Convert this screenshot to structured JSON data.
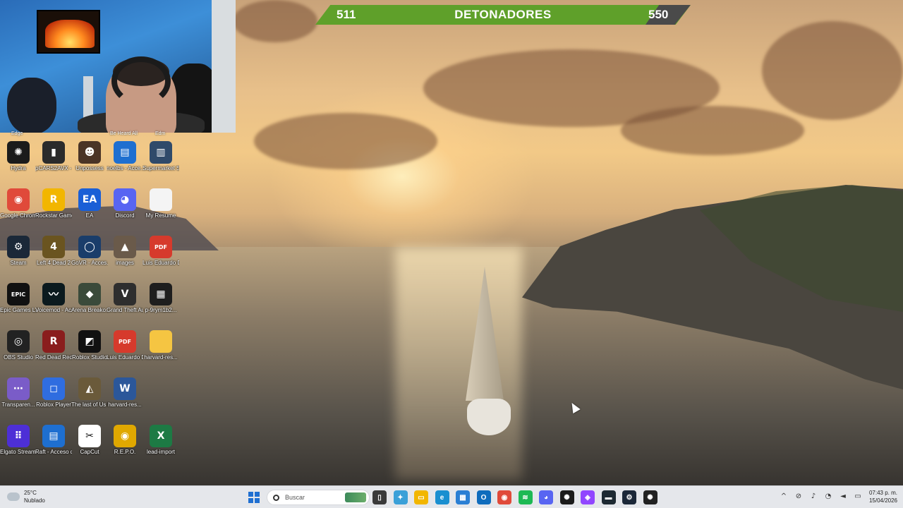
{
  "score_bar": {
    "left_value": "511",
    "title": "DETONADORES",
    "right_value": "550"
  },
  "desktop_icons": [
    {
      "label": "Hydra",
      "icon": "hydra-icon",
      "color": "#1b1b1b",
      "glyph": "✺",
      "col": 0,
      "row": 0
    },
    {
      "label": "pCARS2AVX - Acceso dire...",
      "icon": "pcars-icon",
      "color": "#2b2b2b",
      "glyph": "▮",
      "col": 1,
      "row": 0
    },
    {
      "label": "Unpossess",
      "icon": "unpossess-icon",
      "color": "#4a3426",
      "glyph": "☻",
      "col": 2,
      "row": 0
    },
    {
      "label": "noelbs - Acce...",
      "icon": "shortcut-icon",
      "color": "#1e6fd0",
      "glyph": "▤",
      "col": 3,
      "row": 0
    },
    {
      "label": "Supermarket Simulator",
      "icon": "supermarket-icon",
      "color": "#2f4a6a",
      "glyph": "▥",
      "col": 4,
      "row": 0
    },
    {
      "label": "Google Chrome",
      "icon": "chrome-icon",
      "color": "#e04a3a",
      "glyph": "◉",
      "col": 0,
      "row": 1
    },
    {
      "label": "Rockstar Games ...",
      "icon": "rockstar-icon",
      "color": "#f2b600",
      "glyph": "R",
      "col": 1,
      "row": 1
    },
    {
      "label": "EA",
      "icon": "ea-icon",
      "color": "#1a5fd6",
      "glyph": "EA",
      "col": 2,
      "row": 1
    },
    {
      "label": "Discord",
      "icon": "discord-icon",
      "color": "#5865f2",
      "glyph": "◕",
      "col": 3,
      "row": 1
    },
    {
      "label": "My Resume",
      "icon": "document-icon",
      "color": "#f4f4f4",
      "glyph": "",
      "col": 4,
      "row": 1
    },
    {
      "label": "Steam",
      "icon": "steam-icon",
      "color": "#1b2838",
      "glyph": "⚙",
      "col": 0,
      "row": 2
    },
    {
      "label": "Left 4 Dead 2",
      "icon": "l4d2-icon",
      "color": "#6a5420",
      "glyph": "4",
      "col": 1,
      "row": 2
    },
    {
      "label": "GoVR - Acces...",
      "icon": "govr-icon",
      "color": "#1a3d6a",
      "glyph": "◯",
      "col": 2,
      "row": 2
    },
    {
      "label": "images",
      "icon": "images-icon",
      "color": "#6a5a4a",
      "glyph": "▲",
      "col": 3,
      "row": 2
    },
    {
      "label": "Luis Eduardo Diaz Bernal...",
      "icon": "pdf-icon",
      "color": "#d63a2c",
      "glyph": "PDF",
      "col": 4,
      "row": 2
    },
    {
      "label": "Epic Games Launcher",
      "icon": "epic-icon",
      "color": "#111111",
      "glyph": "EPIC",
      "col": 0,
      "row": 3
    },
    {
      "label": "Voicemod - Acceso di...",
      "icon": "voicemod-icon",
      "color": "#0b1a1e",
      "glyph": "〰",
      "col": 1,
      "row": 3
    },
    {
      "label": "Arena Breako...",
      "icon": "arena-icon",
      "color": "#3a4a3a",
      "glyph": "◆",
      "col": 2,
      "row": 3
    },
    {
      "label": "Grand Theft Auto V",
      "icon": "gta-icon",
      "color": "#2e2e2e",
      "glyph": "V",
      "col": 3,
      "row": 3
    },
    {
      "label": "p-9rym1b2...",
      "icon": "video-icon",
      "color": "#1e1e1e",
      "glyph": "▦",
      "col": 4,
      "row": 3
    },
    {
      "label": "OBS Studio",
      "icon": "obs-icon",
      "color": "#222222",
      "glyph": "◎",
      "col": 0,
      "row": 4
    },
    {
      "label": "Red Dead Redempti...",
      "icon": "rdr-icon",
      "color": "#8a1d1d",
      "glyph": "R",
      "col": 1,
      "row": 4
    },
    {
      "label": "Roblox Studio",
      "icon": "roblox-studio-icon",
      "color": "#111111",
      "glyph": "◩",
      "col": 2,
      "row": 4
    },
    {
      "label": "Luis Eduardo Diaz Bernal...",
      "icon": "pdf-icon",
      "color": "#d63a2c",
      "glyph": "PDF",
      "col": 3,
      "row": 4
    },
    {
      "label": "harvard-res...",
      "icon": "folder-icon",
      "color": "#f5c542",
      "glyph": "",
      "col": 4,
      "row": 4
    },
    {
      "label": "Transparen...",
      "icon": "transparent-icon",
      "color": "#7a5cc8",
      "glyph": "⋯",
      "col": 0,
      "row": 5
    },
    {
      "label": "Roblox Player",
      "icon": "roblox-icon",
      "color": "#2f6de0",
      "glyph": "◻",
      "col": 1,
      "row": 5
    },
    {
      "label": "The last of Us Parte I",
      "icon": "tlou-icon",
      "color": "#6a5a3a",
      "glyph": "◭",
      "col": 2,
      "row": 5
    },
    {
      "label": "harvard-res...",
      "icon": "word-icon",
      "color": "#2b579a",
      "glyph": "W",
      "col": 3,
      "row": 5
    },
    {
      "label": "Elgato Stream Deck",
      "icon": "streamdeck-icon",
      "color": "#4d2fd6",
      "glyph": "⠿",
      "col": 0,
      "row": 6
    },
    {
      "label": "Raft - Acceso directo",
      "icon": "raft-icon",
      "color": "#1e6fd0",
      "glyph": "▤",
      "col": 1,
      "row": 6
    },
    {
      "label": "CapCut",
      "icon": "capcut-icon",
      "color": "#ffffff",
      "glyph": "✂",
      "col": 2,
      "row": 6
    },
    {
      "label": "R.E.P.O.",
      "icon": "repo-icon",
      "color": "#e0a800",
      "glyph": "◉",
      "col": 3,
      "row": 6
    },
    {
      "label": "lead-import",
      "icon": "excel-icon",
      "color": "#1d7a44",
      "glyph": "X",
      "col": 4,
      "row": 6
    }
  ],
  "cut_labels": [
    "Edge",
    "Be Heard All",
    "Edm"
  ],
  "taskbar": {
    "weather_temp": "25°C",
    "weather_desc": "Nublado",
    "search_placeholder": "Buscar",
    "apps": [
      {
        "name": "taskview-icon",
        "color": "#3a3a3a",
        "glyph": "▯"
      },
      {
        "name": "copilot-icon",
        "color": "#3aa0d8",
        "glyph": "✦"
      },
      {
        "name": "file-explorer-icon",
        "color": "#f2b600",
        "glyph": "▭"
      },
      {
        "name": "edge-icon",
        "color": "#1a8fd0",
        "glyph": "e"
      },
      {
        "name": "store-icon",
        "color": "#2a7fd4",
        "glyph": "▦"
      },
      {
        "name": "outlook-icon",
        "color": "#0f6cbd",
        "glyph": "O"
      },
      {
        "name": "chrome-icon",
        "color": "#e04a3a",
        "glyph": "◉"
      },
      {
        "name": "spotify-icon",
        "color": "#1db954",
        "glyph": "≋"
      },
      {
        "name": "discord-icon",
        "color": "#5865f2",
        "glyph": "◕"
      },
      {
        "name": "hydra-icon",
        "color": "#1b1b1b",
        "glyph": "✺"
      },
      {
        "name": "twitch-icon",
        "color": "#9146ff",
        "glyph": "◈"
      },
      {
        "name": "terminal-icon",
        "color": "#1e2a33",
        "glyph": "▬"
      },
      {
        "name": "steam-icon",
        "color": "#1b2838",
        "glyph": "⚙"
      },
      {
        "name": "game-icon",
        "color": "#222222",
        "glyph": "✺"
      }
    ],
    "tray": [
      {
        "name": "chevron-up-icon",
        "glyph": "^"
      },
      {
        "name": "network-off-icon",
        "glyph": "⊘"
      },
      {
        "name": "microphone-icon",
        "glyph": "♪"
      },
      {
        "name": "wifi-icon",
        "glyph": "◔"
      },
      {
        "name": "volume-icon",
        "glyph": "◄"
      },
      {
        "name": "battery-icon",
        "glyph": "▭"
      }
    ],
    "time": "07:43 p. m.",
    "date": "15/04/2026"
  }
}
